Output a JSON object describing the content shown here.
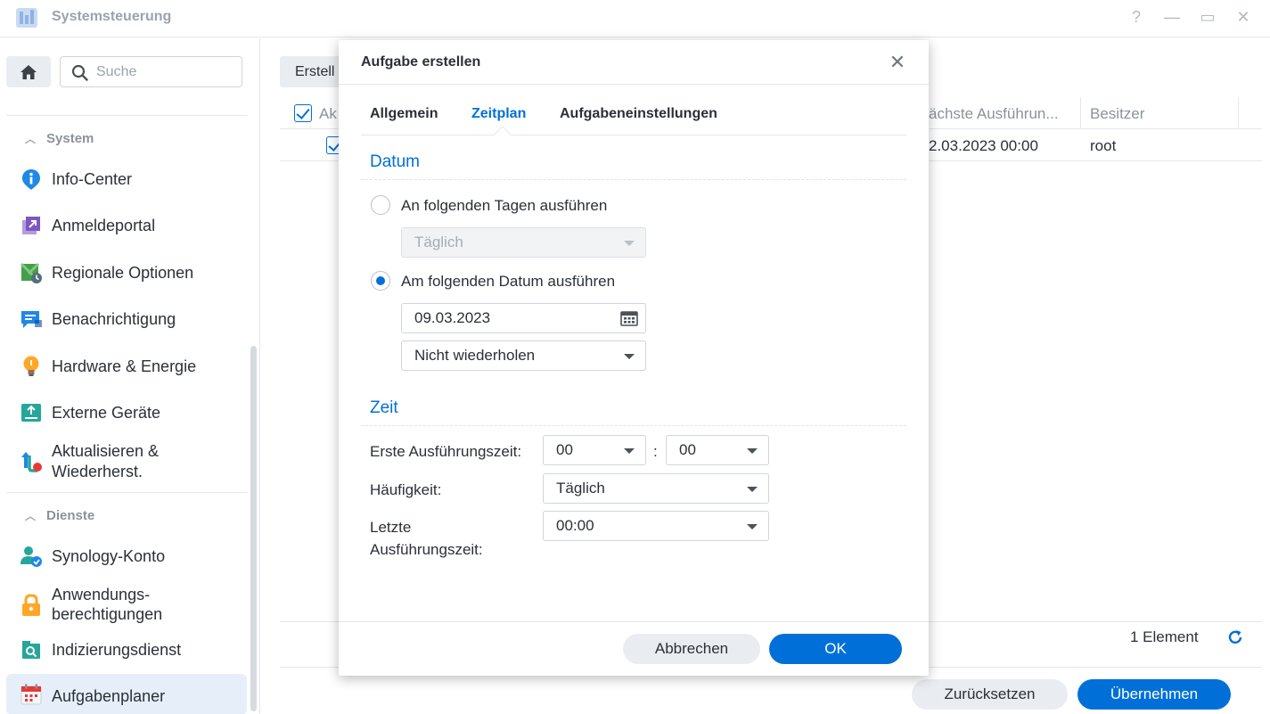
{
  "window": {
    "title": "Systemsteuerung",
    "help_label": "?",
    "minimize_label": "—",
    "maximize_label": "▭",
    "close_label": "✕"
  },
  "sidebar": {
    "search_placeholder": "Suche",
    "groups": [
      {
        "title": "System"
      },
      {
        "title": "Dienste"
      }
    ],
    "items": [
      {
        "label": "Info-Center",
        "icon": "info-icon"
      },
      {
        "label": "Anmeldeportal",
        "icon": "login-portal-icon"
      },
      {
        "label": "Regionale Optionen",
        "icon": "regional-options-icon"
      },
      {
        "label": "Benachrichtigung",
        "icon": "notification-icon"
      },
      {
        "label": "Hardware & Energie",
        "icon": "hardware-power-icon"
      },
      {
        "label": "Externe Geräte",
        "icon": "external-devices-icon"
      },
      {
        "label": "Aktualisieren &",
        "label2": "Wiederherst.",
        "icon": "update-restore-icon"
      },
      {
        "label": "Synology-Konto",
        "icon": "synology-account-icon"
      },
      {
        "label": "Anwendungs-",
        "label2": "berechtigungen",
        "icon": "app-permissions-icon"
      },
      {
        "label": "Indizierungsdienst",
        "icon": "indexing-service-icon"
      },
      {
        "label": "Aufgabenplaner",
        "icon": "task-scheduler-icon"
      }
    ]
  },
  "main": {
    "create_label": "Erstell",
    "columns": {
      "enabled": "Ak",
      "next_run": "ächste Ausführun...",
      "owner": "Besitzer"
    },
    "row": {
      "next_run": "2.03.2023 00:00",
      "owner": "root"
    },
    "count": "1 Element",
    "reset_label": "Zurücksetzen",
    "apply_label": "Übernehmen"
  },
  "dialog": {
    "title": "Aufgabe erstellen",
    "close_label": "✕",
    "tabs": [
      {
        "label": "Allgemein"
      },
      {
        "label": "Zeitplan"
      },
      {
        "label": "Aufgabeneinstellungen"
      }
    ],
    "date_section": "Datum",
    "radio_days_label": "An folgenden Tagen ausführen",
    "days_select": "Täglich",
    "radio_date_label": "Am folgenden Datum ausführen",
    "date_value": "09.03.2023",
    "repeat_select": "Nicht wiederholen",
    "time_section": "Zeit",
    "first_run_label": "Erste Ausführungszeit:",
    "first_run_hour": "00",
    "time_colon": ":",
    "first_run_minute": "00",
    "frequency_label": "Häufigkeit:",
    "frequency_value": "Täglich",
    "last_run_label_1": "Letzte",
    "last_run_label_2": "Ausführungszeit:",
    "last_run_value": "00:00",
    "cancel_label": "Abbrechen",
    "ok_label": "OK"
  },
  "colors": {
    "accent": "#0070d8",
    "muted": "#8a939c",
    "border": "#e4e7eb"
  }
}
